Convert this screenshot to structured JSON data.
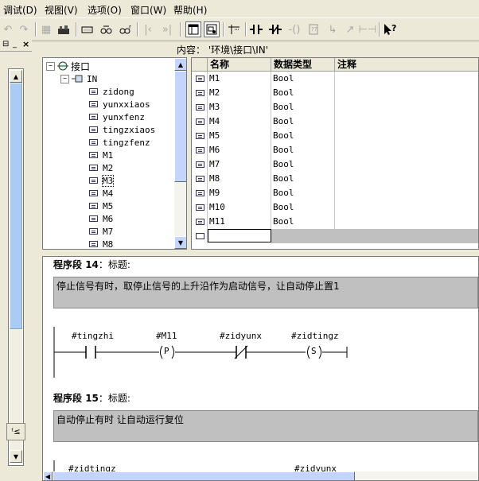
{
  "menubar": {
    "items": [
      "调试(D)",
      "视图(V)",
      "选项(O)",
      "窗口(W)",
      "帮助(H)"
    ]
  },
  "toolbar": {
    "buttons": [
      "undo-icon",
      "redo-icon",
      "compile-icon",
      "download-icon",
      "overview-icon",
      "monitor-icon",
      "first-icon",
      "last-icon",
      "module-icon",
      "detail-icon",
      "network-icon",
      "contact-no-icon",
      "contact-nc-icon",
      "coil-icon",
      "box-icon",
      "branch-icon",
      "branch-close-icon",
      "connector-icon",
      "help-icon"
    ]
  },
  "content": {
    "label": "内容：  '环境\\接口\\IN'"
  },
  "tree": {
    "root": "接口",
    "in_node": "IN",
    "items": [
      "zidong",
      "yunxxiaos",
      "yunxfenz",
      "tingzxiaos",
      "tingzfenz",
      "M1",
      "M2",
      "M3",
      "M4",
      "M5",
      "M6",
      "M7",
      "M8"
    ],
    "selected": "M3"
  },
  "table": {
    "headers": [
      "名称",
      "数据类型",
      "注释"
    ],
    "rows": [
      {
        "name": "M1",
        "type": "Bool"
      },
      {
        "name": "M2",
        "type": "Bool"
      },
      {
        "name": "M3",
        "type": "Bool"
      },
      {
        "name": "M4",
        "type": "Bool"
      },
      {
        "name": "M5",
        "type": "Bool"
      },
      {
        "name": "M6",
        "type": "Bool"
      },
      {
        "name": "M7",
        "type": "Bool"
      },
      {
        "name": "M8",
        "type": "Bool"
      },
      {
        "name": "M9",
        "type": "Bool"
      },
      {
        "name": "M10",
        "type": "Bool"
      },
      {
        "name": "M11",
        "type": "Bool"
      }
    ]
  },
  "network": {
    "seg14": {
      "prefix": "程序段",
      "number": "14",
      "suffix": "：",
      "title": "标题:",
      "comment": "停止信号有时，取停止信号的上升沿作为启动信号，让自动停止置1",
      "labels": [
        "#tingzhi",
        "#M11",
        "#zidyunx",
        "#zidtingz"
      ],
      "p_text": "P",
      "s_text": "S"
    },
    "seg15": {
      "prefix": "程序段",
      "number": "15",
      "suffix": "：",
      "title": "标题:",
      "comment": "自动停止有时 让自动运行复位",
      "labels": [
        "#zidtingz",
        "#zidyunx"
      ]
    }
  },
  "colors": {
    "window_bg": "#ece9d8",
    "comment_bg": "#c0c0c0",
    "empty_row_bg": "#c0c0c0"
  }
}
